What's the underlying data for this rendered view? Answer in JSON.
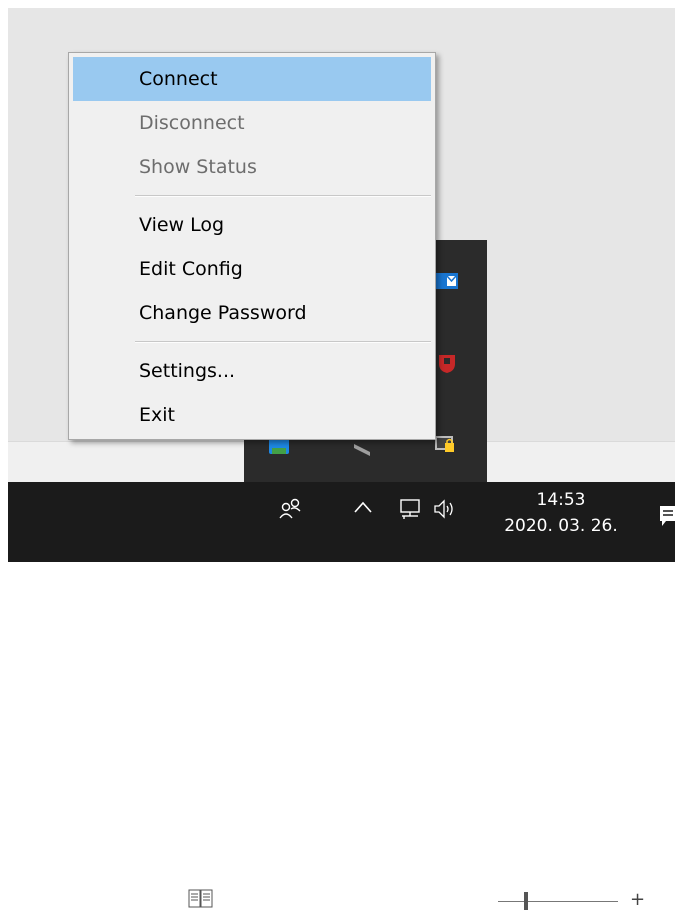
{
  "menu": {
    "items": [
      {
        "label": "Connect",
        "state": "highlighted"
      },
      {
        "label": "Disconnect",
        "state": "disabled"
      },
      {
        "label": "Show Status",
        "state": "disabled"
      },
      {
        "label": "View Log",
        "state": "enabled"
      },
      {
        "label": "Edit Config",
        "state": "enabled"
      },
      {
        "label": "Change Password",
        "state": "enabled"
      },
      {
        "label": "Settings...",
        "state": "enabled"
      },
      {
        "label": "Exit",
        "state": "enabled"
      }
    ]
  },
  "statusbar": {
    "zoom_plus": "+"
  },
  "taskbar": {
    "time": "14:53",
    "date": "2020. 03. 26."
  },
  "icons": {
    "people": "people-icon",
    "chevron": "chevron-up-icon",
    "network": "network-icon",
    "volume": "volume-icon",
    "notifications": "notification-icon"
  },
  "colors": {
    "highlight": "#99c9f0",
    "disabled_text": "#6d6d6d",
    "taskbar": "#1b1b1b",
    "tray_flyout": "#2b2b2b"
  }
}
